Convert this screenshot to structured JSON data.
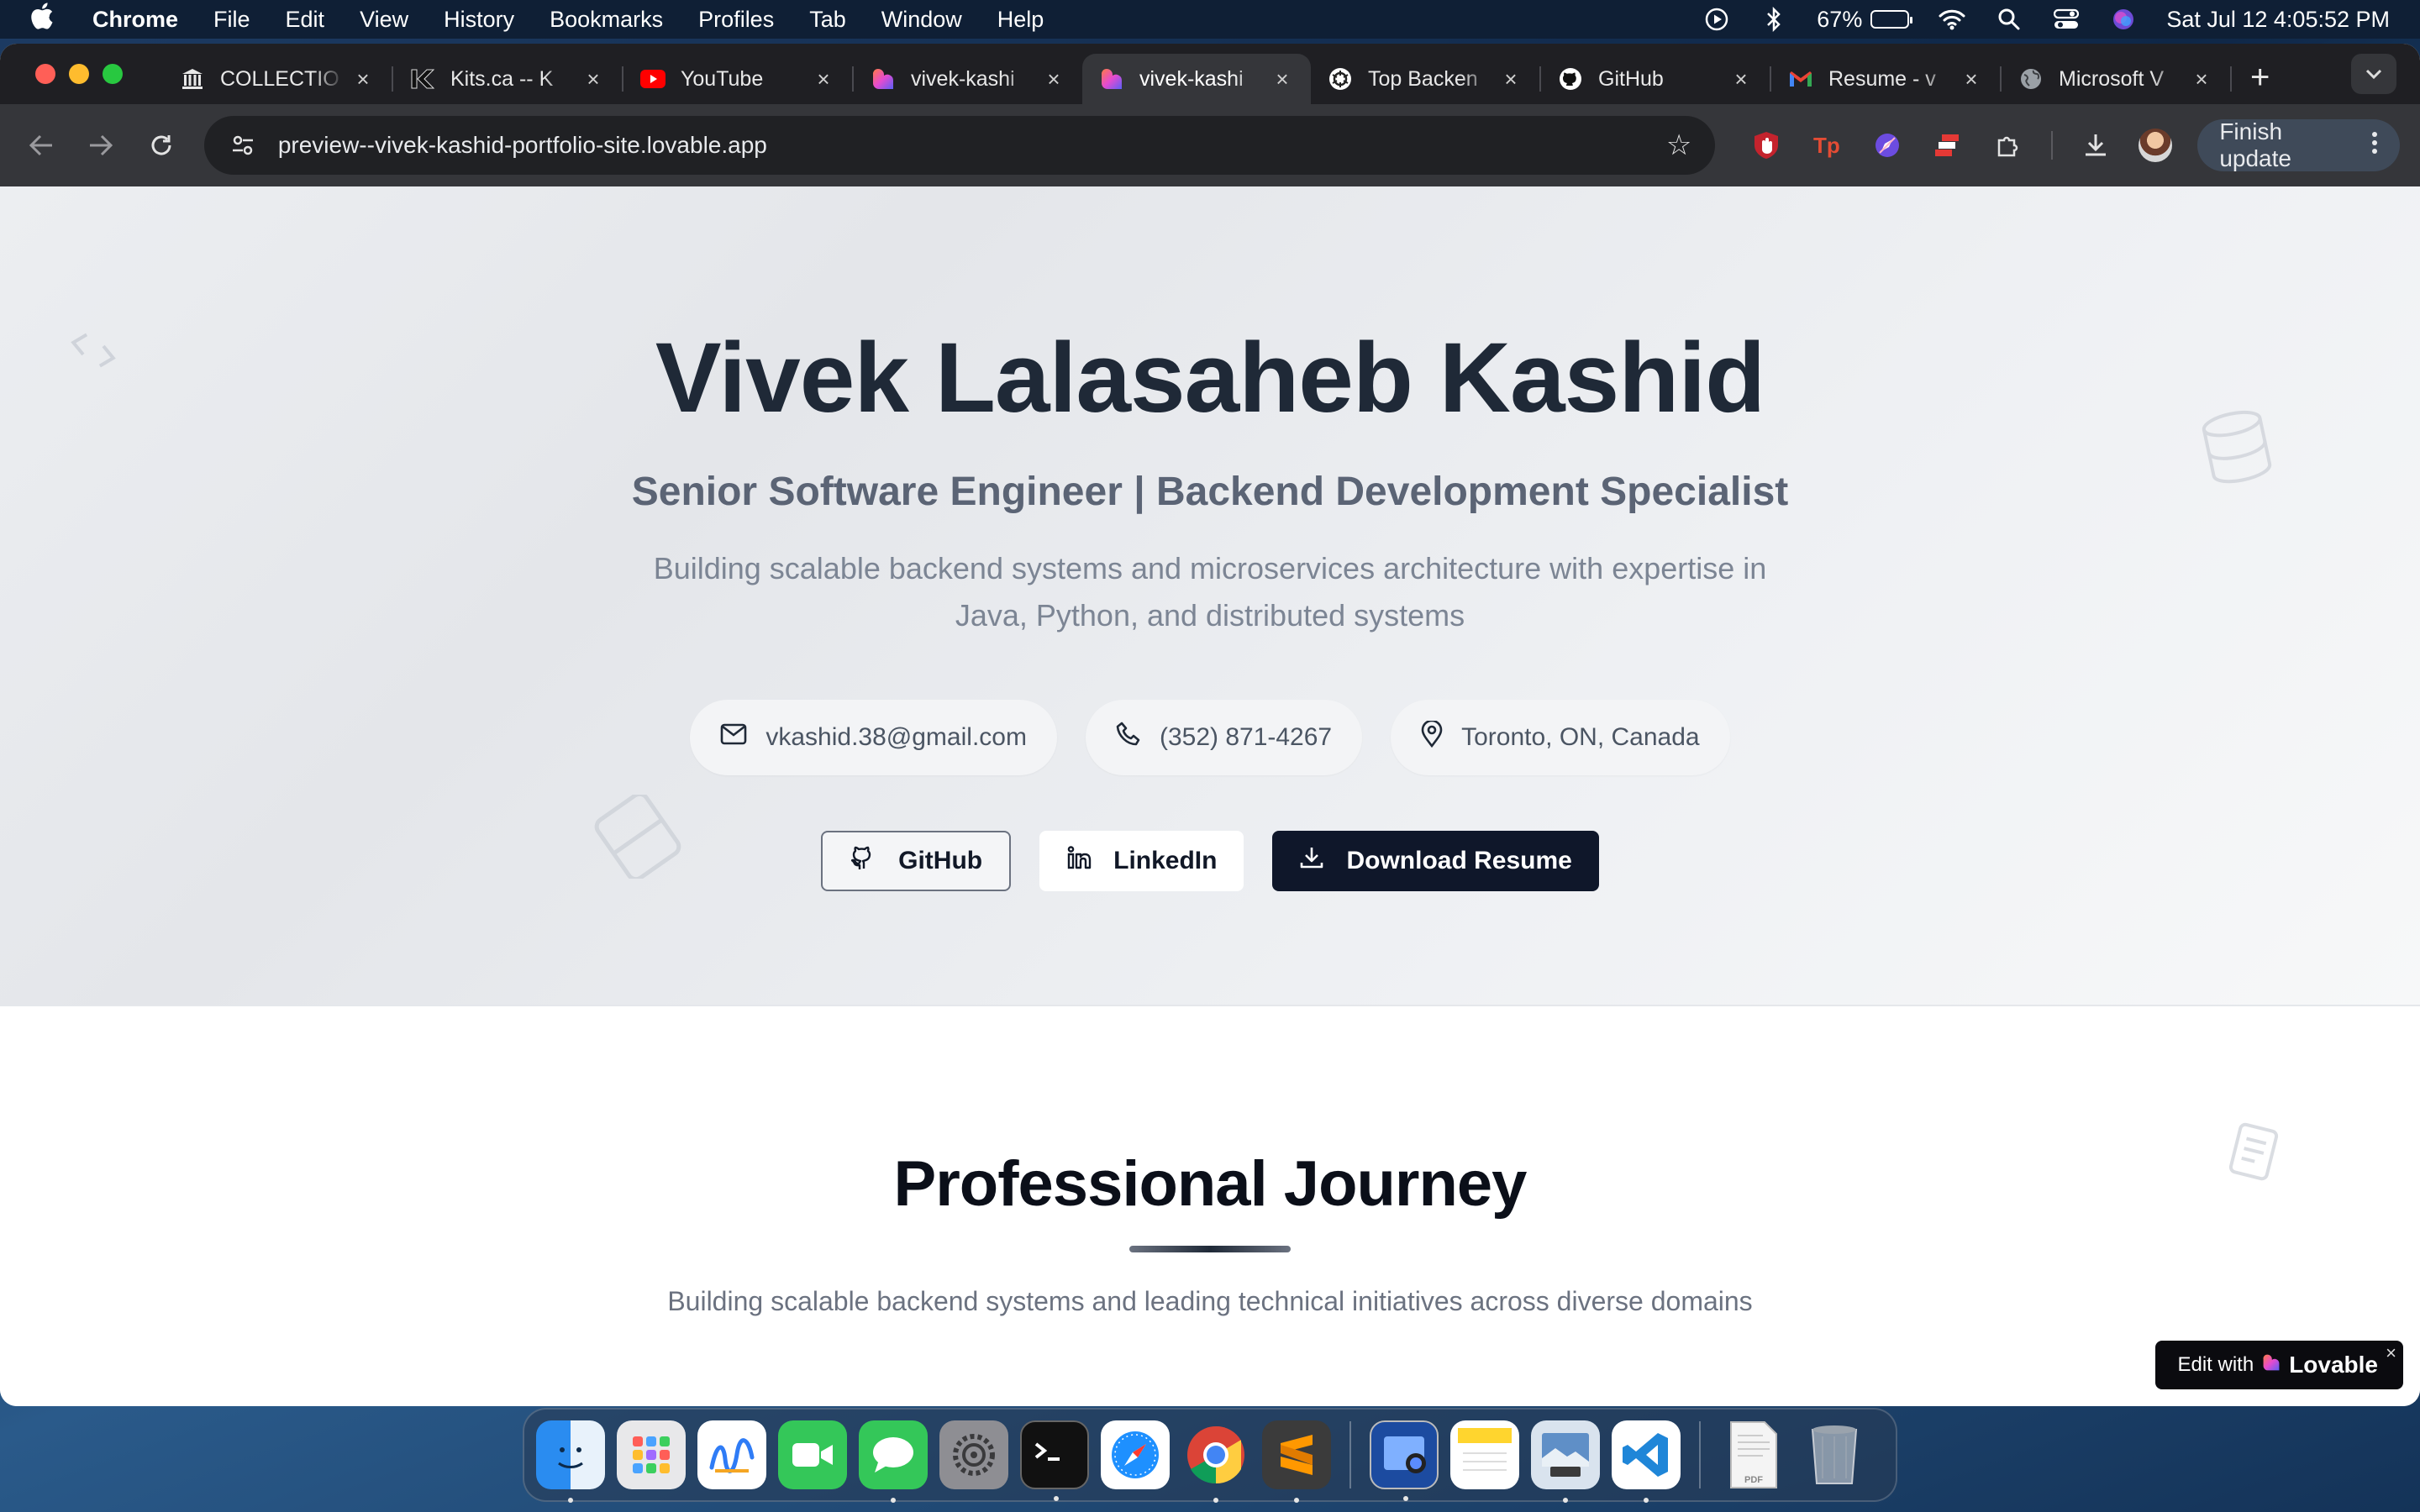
{
  "menubar": {
    "app_name": "Chrome",
    "menus": [
      "File",
      "Edit",
      "View",
      "History",
      "Bookmarks",
      "Profiles",
      "Tab",
      "Window",
      "Help"
    ],
    "battery": "67%",
    "datetime": "Sat Jul 12  4:05:52 PM"
  },
  "tabs": [
    {
      "title": "COLLECTIO",
      "icon": "museum-icon"
    },
    {
      "title": "Kits.ca -- K",
      "icon": "kits-icon"
    },
    {
      "title": "YouTube",
      "icon": "youtube-icon"
    },
    {
      "title": "vivek-kashi",
      "icon": "lovable-icon"
    },
    {
      "title": "vivek-kashi",
      "icon": "lovable-icon",
      "active": true
    },
    {
      "title": "Top Backen",
      "icon": "openai-icon"
    },
    {
      "title": "GitHub",
      "icon": "github-icon"
    },
    {
      "title": "Resume - v",
      "icon": "gmail-icon"
    },
    {
      "title": "Microsoft V",
      "icon": "globe-icon"
    }
  ],
  "toolbar": {
    "url": "preview--vivek-kashid-portfolio-site.lovable.app",
    "finish_update": "Finish update"
  },
  "hero": {
    "name": "Vivek Lalasaheb Kashid",
    "subtitle": "Senior Software Engineer | Backend Development Specialist",
    "tagline": "Building scalable backend systems and microservices architecture with expertise in Java, Python, and distributed systems",
    "email": "vkashid.38@gmail.com",
    "phone": "(352) 871-4267",
    "location": "Toronto, ON, Canada",
    "github_label": "GitHub",
    "linkedin_label": "LinkedIn",
    "resume_label": "Download Resume"
  },
  "journey": {
    "title": "Professional Journey",
    "subtitle": "Building scalable backend systems and leading technical initiatives across diverse domains"
  },
  "badge": {
    "prefix": "Edit with",
    "brand": "Lovable",
    "close": "×"
  },
  "dock": [
    "Finder",
    "Launchpad",
    "Freeform",
    "FaceTime",
    "Messages",
    "System Settings",
    "Terminal",
    "Safari",
    "Chrome",
    "Sublime Text",
    "Preview",
    "Notes",
    "Image Capture",
    "VS Code",
    "PDF Document",
    "Trash"
  ],
  "colors": {
    "accent_dark": "#0f172a",
    "heading": "#1f2937",
    "chrome_tabstrip": "#1f1f23",
    "chrome_toolbar": "#35363a"
  }
}
